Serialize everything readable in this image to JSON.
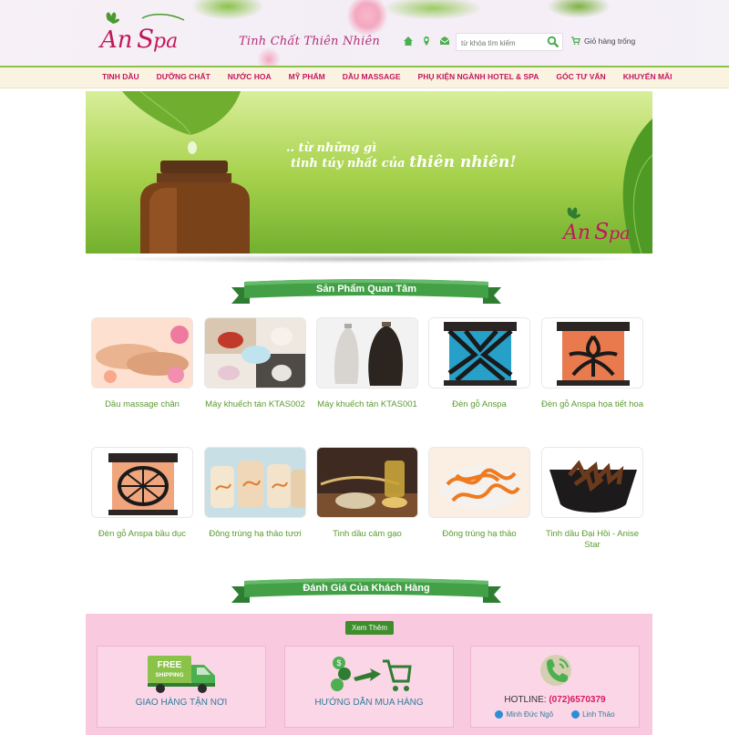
{
  "brand": {
    "name": "AnSpa",
    "tagline": "Tinh Chất Thiên Nhiên"
  },
  "header": {
    "icons": [
      "home-icon",
      "map-pin-icon",
      "mail-icon"
    ],
    "search_placeholder": "từ khóa tìm kiếm",
    "cart_label": "Giỏ hàng trống"
  },
  "nav": [
    "Tinh dầu",
    "Dưỡng chất",
    "Nước hoa",
    "Mỹ phẩm",
    "Dầu massage",
    "Phụ kiện ngành Hotel & Spa",
    "Góc tư vấn",
    "Khuyến mãi"
  ],
  "banner": {
    "line1": ".. từ những gì",
    "line2": "tinh túy nhất của",
    "line2_emph": "thiên nhiên!",
    "logo": "AnSpa"
  },
  "section1": {
    "title": "Sản Phẩm Quan Tâm"
  },
  "products_row1": [
    "Dầu massage chân",
    "Máy khuếch tán KTAS002",
    "Máy khuếch tán KTAS001",
    "Đèn gỗ Anspa",
    "Đèn gỗ Anspa họa tiết hoa"
  ],
  "products_row2": [
    "Đèn gỗ Anspa bầu dục",
    "Đông trùng hạ thảo tươi",
    "Tinh dầu cám gạo",
    "Đông trùng hạ thảo",
    "Tinh dầu Đại Hồi - Anise Star"
  ],
  "section2": {
    "title": "Đánh Giá Của Khách Hàng",
    "more_button": "Xem Thêm"
  },
  "features": {
    "shipping": {
      "badge_line1": "FREE",
      "badge_line2": "SHIPPING",
      "label": "GIAO HÀNG TẬN NƠI"
    },
    "guide": {
      "label": "HƯỚNG DẪN MUA HÀNG"
    },
    "hotline": {
      "label": "HOTLINE:",
      "number": "(072)6570379",
      "contacts": [
        "Minh Đức Ngô",
        "Linh Thảo"
      ]
    }
  },
  "colors": {
    "brand_pink": "#c2185b",
    "green": "#5b9a2f",
    "ribbon_green": "#3f9a2e",
    "footer_pink": "#f9c9e0"
  }
}
